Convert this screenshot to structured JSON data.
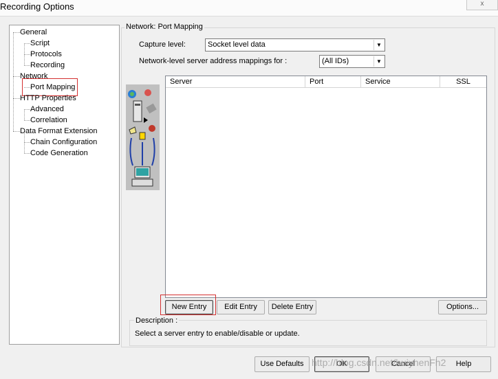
{
  "window": {
    "title": "Recording Options",
    "close_glyph": "x"
  },
  "tree": {
    "items": [
      {
        "label": "General"
      },
      {
        "label": "Script"
      },
      {
        "label": "Protocols"
      },
      {
        "label": "Recording"
      },
      {
        "label": "Network"
      },
      {
        "label": "Port Mapping"
      },
      {
        "label": "HTTP Properties"
      },
      {
        "label": "Advanced"
      },
      {
        "label": "Correlation"
      },
      {
        "label": "Data Format Extension"
      },
      {
        "label": "Chain Configuration"
      },
      {
        "label": "Code Generation"
      }
    ]
  },
  "group": {
    "title": "Network: Port Mapping",
    "capture_level_label": "Capture level:",
    "capture_level_value": "Socket level data",
    "mappings_label": "Network-level server address mappings for :",
    "mappings_value": "(All IDs)"
  },
  "table": {
    "columns": [
      "Server",
      "Port",
      "Service",
      "SSL"
    ]
  },
  "entry_buttons": {
    "new": "New Entry",
    "edit": "Edit Entry",
    "delete": "Delete Entry",
    "options": "Options..."
  },
  "description": {
    "title": "Description :",
    "text": "Select a server entry to enable/disable or update."
  },
  "footer": {
    "use_defaults": "Use Defaults",
    "ok": "OK",
    "cancel": "Cancel",
    "help": "Help"
  },
  "watermark": "http://blog.csdn.net/huiyhenFh2"
}
